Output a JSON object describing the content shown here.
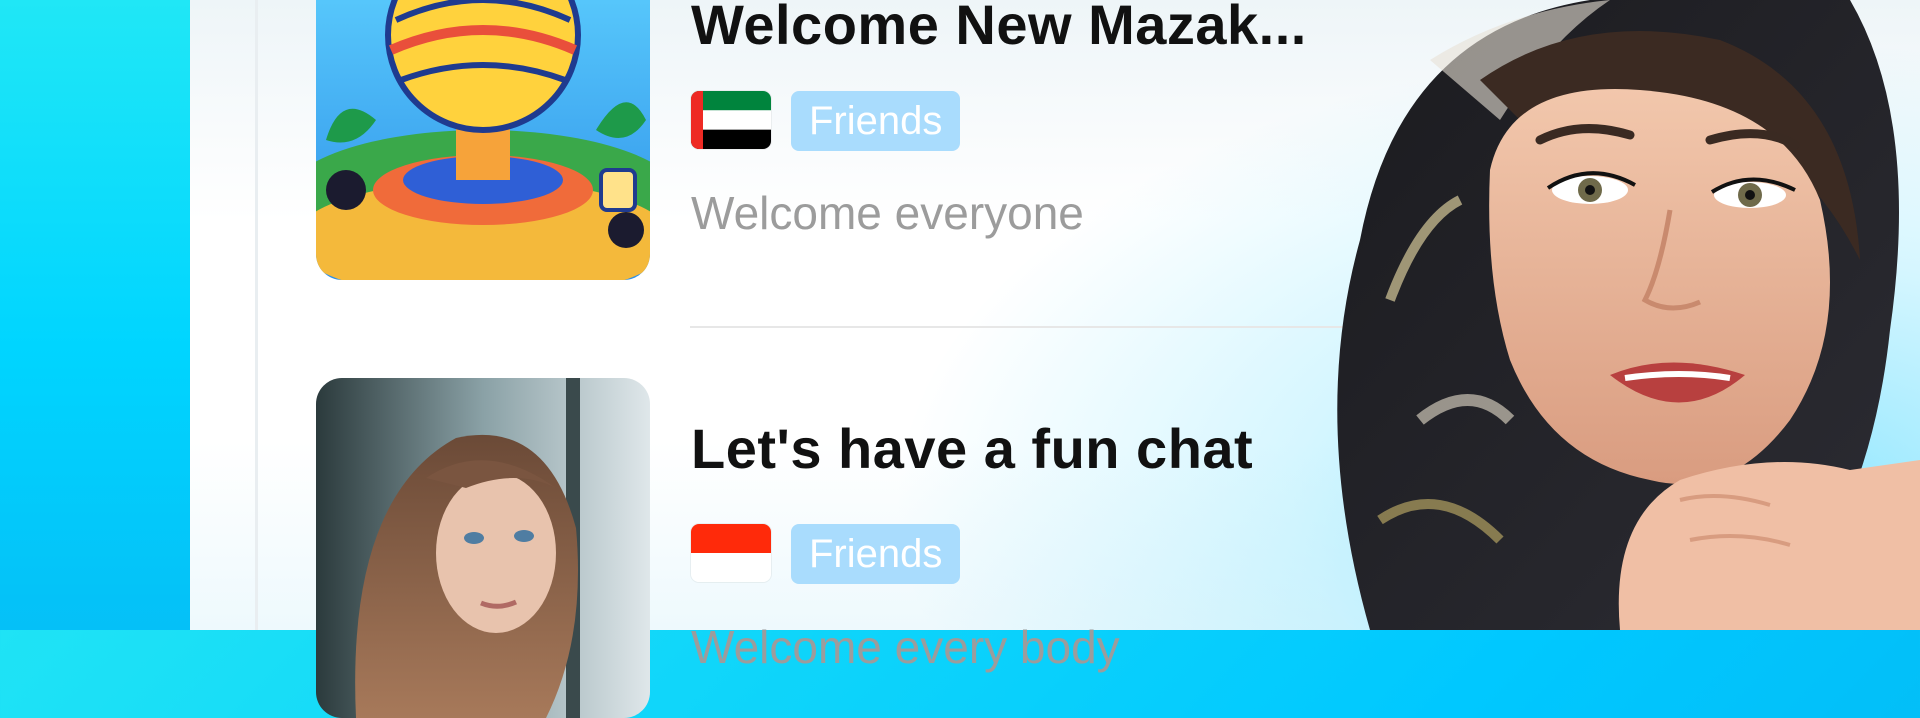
{
  "rooms": [
    {
      "title": "Welcome New Mazak...",
      "flag": "UAE",
      "tag": "Friends",
      "description": "Welcome everyone",
      "thumbnail": "illustrated-globe-stage"
    },
    {
      "title": "Let's have a fun chat",
      "flag": "Indonesia",
      "tag": "Friends",
      "description": "Welcome every body",
      "thumbnail": "woman-portrait-photo"
    }
  ],
  "colors": {
    "tag_bg": "#a9dcfd",
    "accent": "#00c8ff",
    "title_text": "#111111",
    "description_text": "#9c9c9c"
  }
}
